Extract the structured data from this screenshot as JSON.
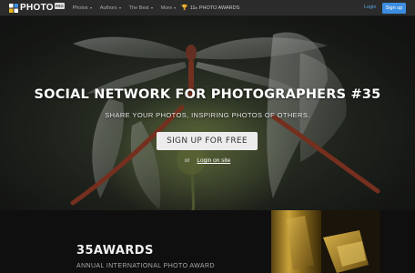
{
  "brand": {
    "name": "PHOTO",
    "badge": "PRO"
  },
  "nav": {
    "items": [
      {
        "label": "Photos"
      },
      {
        "label": "Authors"
      },
      {
        "label": "The Best"
      },
      {
        "label": "More"
      }
    ],
    "awards_prefix": "11",
    "awards_sup": "th",
    "awards_suffix": " PHOTO AWARDS",
    "login": "Login",
    "signup": "Sign up"
  },
  "hero": {
    "title": "SOCIAL NETWORK FOR PHOTOGRAPHERS #35",
    "subtitle": "SHARE YOUR PHOTOS, INSPIRING PHOTOS OF OTHERS.",
    "cta": "SIGN UP FOR FREE",
    "or": "or",
    "login_link": "Login on site"
  },
  "awards": {
    "title": "35AWARDS",
    "subtitle": "ANNUAL INTERNATIONAL PHOTO AWARD"
  },
  "colors": {
    "navbar": "#2b2b2b",
    "accent": "#3c8de0",
    "link": "#5ba8e6",
    "gold": "#e6b520"
  },
  "icons": {
    "logo": "camera-logo-icon",
    "trophy": "trophy-icon",
    "caret": "chevron-down-icon"
  }
}
